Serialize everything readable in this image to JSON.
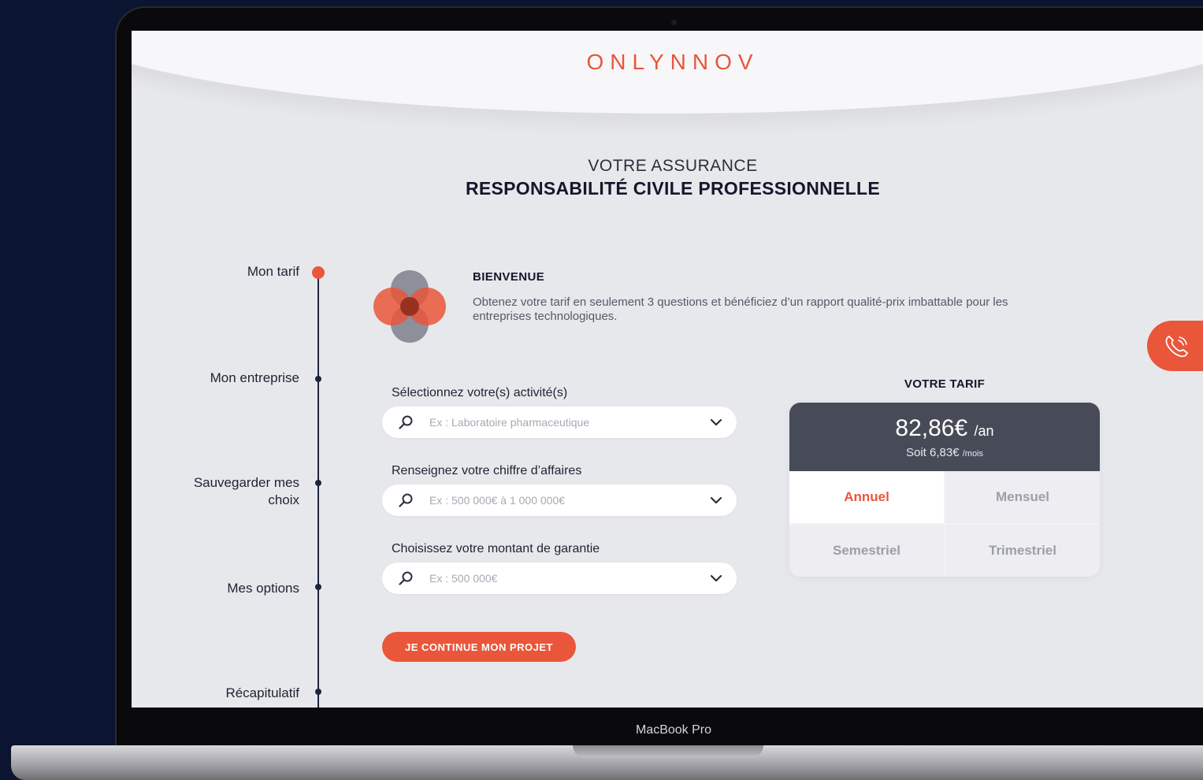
{
  "device": {
    "chin_label": "MacBook Pro"
  },
  "header": {
    "logo": "ONLYNNOV"
  },
  "hero": {
    "subtitle": "VOTRE ASSURANCE",
    "title": "RESPONSABILITÉ CIVILE PROFESSIONNELLE"
  },
  "stepper": {
    "steps": [
      {
        "label": "Mon tarif",
        "active": true
      },
      {
        "label": "Mon entreprise"
      },
      {
        "label_line1": "Sauvegarder mes",
        "label_line2": "choix"
      },
      {
        "label": "Mes options"
      },
      {
        "label": "Récapitulatif"
      }
    ]
  },
  "welcome": {
    "title": "BIENVENUE",
    "text": "Obtenez votre tarif en seulement 3 questions et bénéficiez d’un rapport qualité-prix imbattable pour les entreprises technologiques."
  },
  "form": {
    "fields": [
      {
        "label": "Sélectionnez votre(s) activité(s)",
        "placeholder": "Ex : Laboratoire pharmaceutique"
      },
      {
        "label": "Renseignez votre chiffre d’affaires",
        "placeholder": "Ex : 500 000€ à 1 000 000€"
      },
      {
        "label": "Choisissez votre montant de garantie",
        "placeholder": "Ex : 500 000€"
      }
    ],
    "submit_label": "JE CONTINUE MON PROJET"
  },
  "pricing": {
    "title": "VOTRE TARIF",
    "amount": "82,86€",
    "amount_unit": "/an",
    "monthly_prefix": "Soit 6,83€",
    "monthly_unit": "/mois",
    "options": [
      "Annuel",
      "Mensuel",
      "Semestriel",
      "Trimestriel"
    ],
    "selected": "Annuel"
  },
  "colors": {
    "accent": "#e9563a",
    "navy": "#1e2440",
    "card_dark": "#474b58",
    "background": "#0b1430"
  },
  "icons": {
    "field_icon": "search-icon",
    "dropdown_icon": "chevron-down-icon",
    "contact_icon": "phone-icon"
  }
}
